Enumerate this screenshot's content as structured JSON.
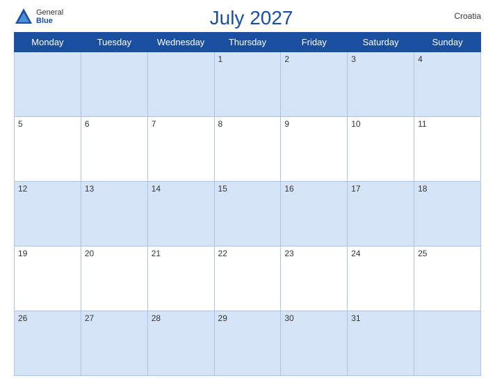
{
  "header": {
    "logo_general": "General",
    "logo_blue": "Blue",
    "title": "July 2027",
    "country": "Croatia"
  },
  "weekdays": [
    "Monday",
    "Tuesday",
    "Wednesday",
    "Thursday",
    "Friday",
    "Saturday",
    "Sunday"
  ],
  "weeks": [
    [
      null,
      null,
      null,
      1,
      2,
      3,
      4
    ],
    [
      5,
      6,
      7,
      8,
      9,
      10,
      11
    ],
    [
      12,
      13,
      14,
      15,
      16,
      17,
      18
    ],
    [
      19,
      20,
      21,
      22,
      23,
      24,
      25
    ],
    [
      26,
      27,
      28,
      29,
      30,
      31,
      null
    ]
  ]
}
